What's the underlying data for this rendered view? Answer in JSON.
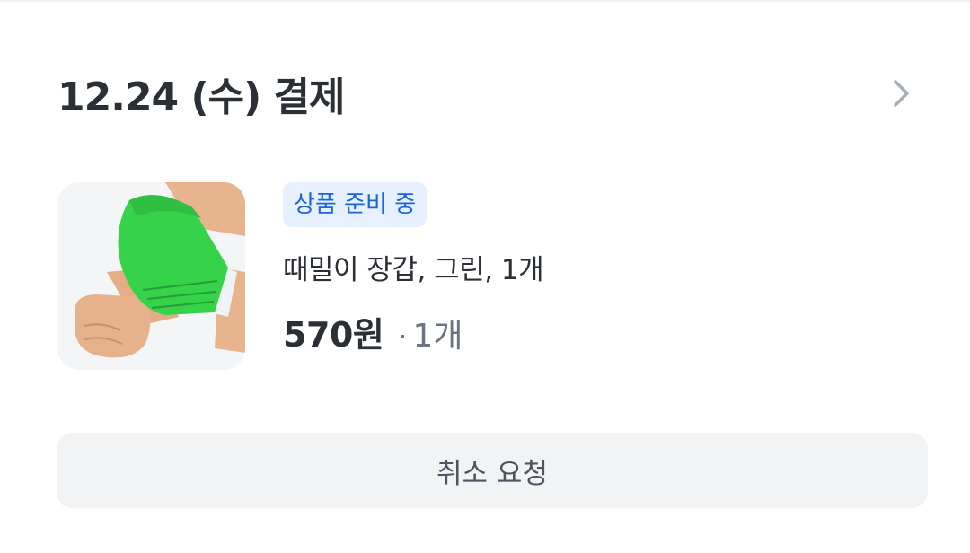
{
  "order": {
    "title": "12.24 (수) 결제",
    "chevron_icon": "chevron-right-icon"
  },
  "product": {
    "status_badge": "상품 준비 중",
    "name": "때밀이 장갑, 그린, 1개",
    "price": "570원",
    "quantity": "1개",
    "image": "green-exfoliating-glove-on-wrist"
  },
  "actions": {
    "cancel_label": "취소 요청"
  },
  "colors": {
    "badge_bg": "#e7f0ff",
    "badge_text": "#1b64da",
    "button_bg": "#f2f3f5",
    "title_text": "#2b2f36"
  }
}
